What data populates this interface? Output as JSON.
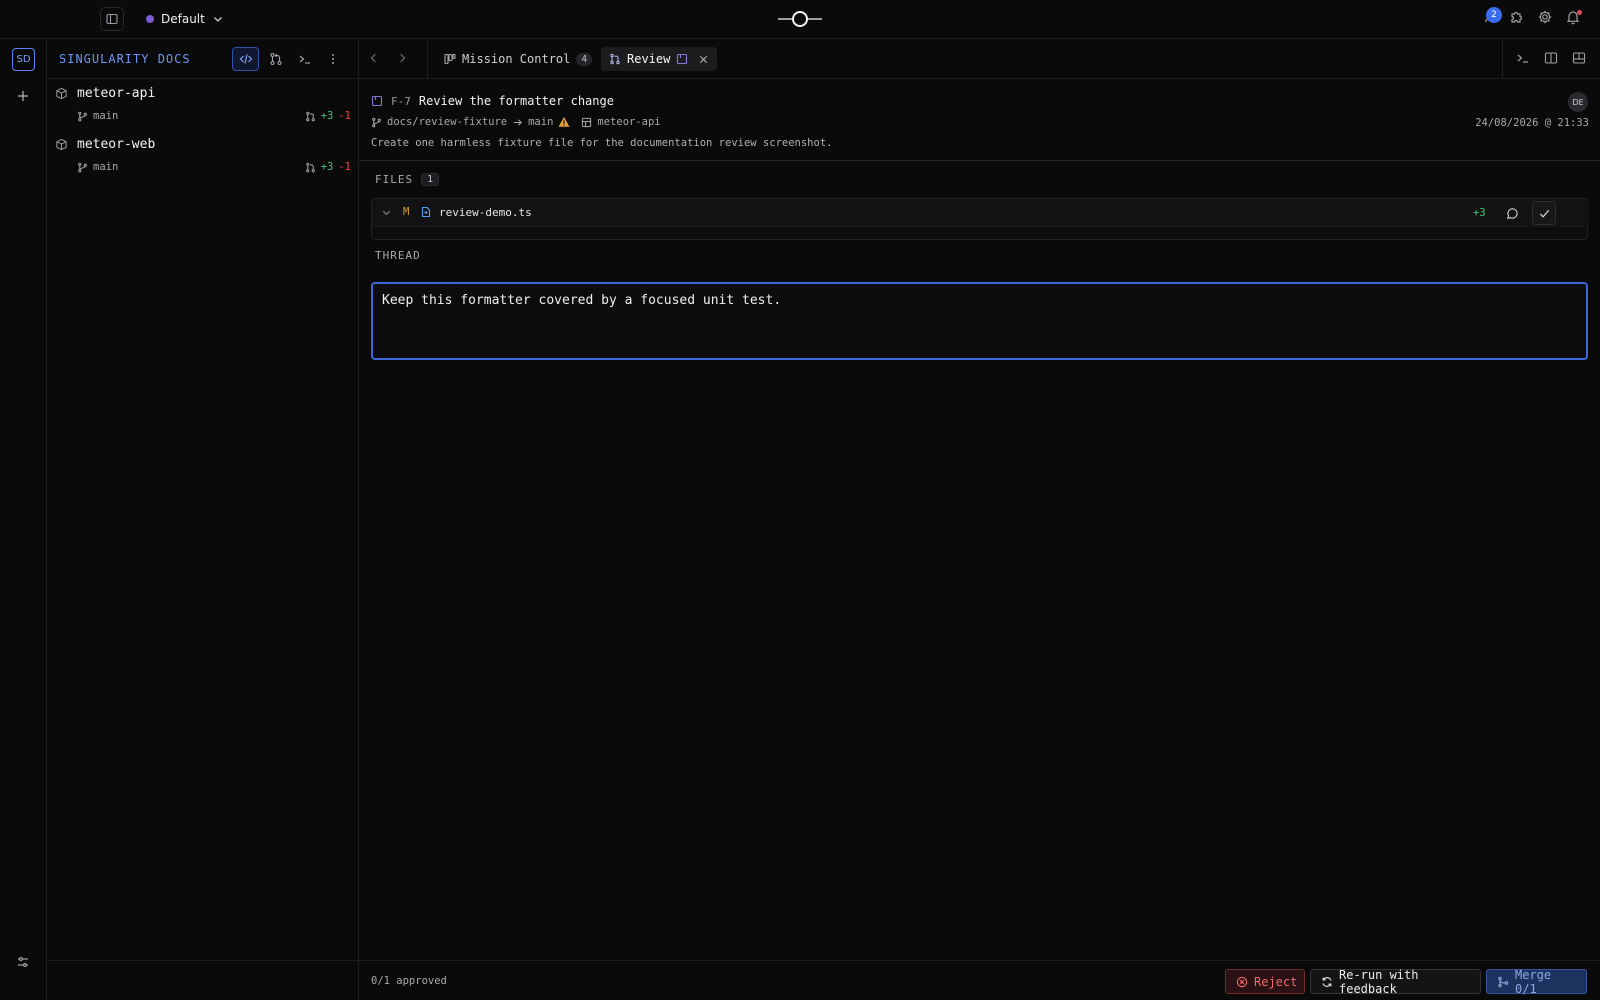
{
  "topbar": {
    "workspace": "Default",
    "notification_count": "2",
    "accent": "#3b6cf0",
    "workspace_color": "#7c5ccf"
  },
  "rail": {
    "project_initials": "SD"
  },
  "sidebar": {
    "title": "SINGULARITY DOCS",
    "repos": [
      {
        "name": "meteor-api",
        "branch": "main",
        "additions": "+3",
        "deletions": "-1"
      },
      {
        "name": "meteor-web",
        "branch": "main",
        "additions": "+3",
        "deletions": "-1"
      }
    ]
  },
  "tabs": [
    {
      "label": "Mission Control",
      "count": "4",
      "active": false
    },
    {
      "label": "Review",
      "active": true
    }
  ],
  "task": {
    "key": "F-7",
    "title": "Review the formatter change",
    "source_branch": "docs/review-fixture",
    "target_branch": "main",
    "repo": "meteor-api",
    "timestamp": "24/08/2026 @ 21:33",
    "description": "Create one harmless fixture file for the documentation review screenshot.",
    "assignee_initials": "DE"
  },
  "files": {
    "label": "FILES",
    "count": "1",
    "items": [
      {
        "status": "M",
        "name": "review-demo.ts",
        "additions": "+3"
      }
    ]
  },
  "thread": {
    "label": "THREAD",
    "text": "Keep this formatter covered by a focused unit test."
  },
  "footer": {
    "approved": "0/1 approved",
    "reject": "Reject",
    "rerun": "Re-run with feedback",
    "merge": "Merge 0/1"
  }
}
